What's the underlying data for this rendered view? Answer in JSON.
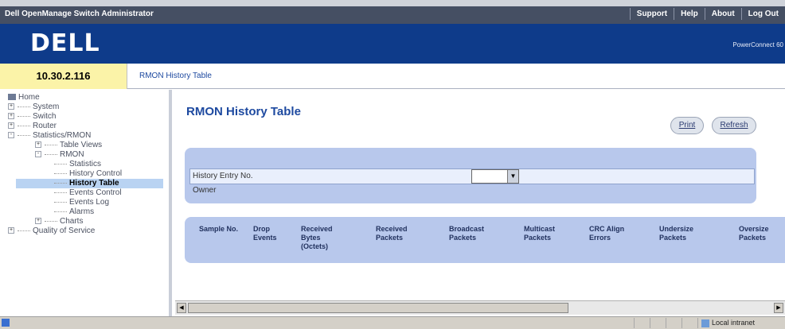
{
  "header": {
    "app_title": "Dell OpenManage Switch Administrator",
    "nav": [
      "Support",
      "Help",
      "About",
      "Log Out"
    ],
    "logo": "DELL",
    "model": "PowerConnect 60"
  },
  "address": {
    "ip": "10.30.2.116",
    "breadcrumb": "RMON History Table"
  },
  "tree": [
    {
      "label": "Home",
      "level": 0,
      "expander": ""
    },
    {
      "label": "System",
      "level": 1,
      "expander": "+"
    },
    {
      "label": "Switch",
      "level": 1,
      "expander": "+"
    },
    {
      "label": "Router",
      "level": 1,
      "expander": "+"
    },
    {
      "label": "Statistics/RMON",
      "level": 1,
      "expander": "-"
    },
    {
      "label": "Table Views",
      "level": 2,
      "expander": "+"
    },
    {
      "label": "RMON",
      "level": 2,
      "expander": "-"
    },
    {
      "label": "Statistics",
      "level": 3,
      "expander": ""
    },
    {
      "label": "History Control",
      "level": 3,
      "expander": ""
    },
    {
      "label": "History Table",
      "level": 3,
      "expander": "",
      "selected": true
    },
    {
      "label": "Events Control",
      "level": 3,
      "expander": ""
    },
    {
      "label": "Events Log",
      "level": 3,
      "expander": ""
    },
    {
      "label": "Alarms",
      "level": 3,
      "expander": ""
    },
    {
      "label": "Charts",
      "level": 2,
      "expander": "+"
    },
    {
      "label": "Quality of Service",
      "level": 1,
      "expander": "+"
    }
  ],
  "main": {
    "title": "RMON History Table",
    "print_label": "Print",
    "refresh_label": "Refresh",
    "form": {
      "history_entry_label": "History Entry No.",
      "history_entry_value": "",
      "owner_label": "Owner"
    },
    "table": {
      "columns": [
        "Sample No.",
        "Drop Events",
        "Received Bytes (Octets)",
        "Received Packets",
        "Broadcast Packets",
        "Multicast Packets",
        "CRC Align Errors",
        "Undersize Packets",
        "Oversize Packets"
      ]
    }
  },
  "statusbar": {
    "zone": "Local intranet"
  }
}
